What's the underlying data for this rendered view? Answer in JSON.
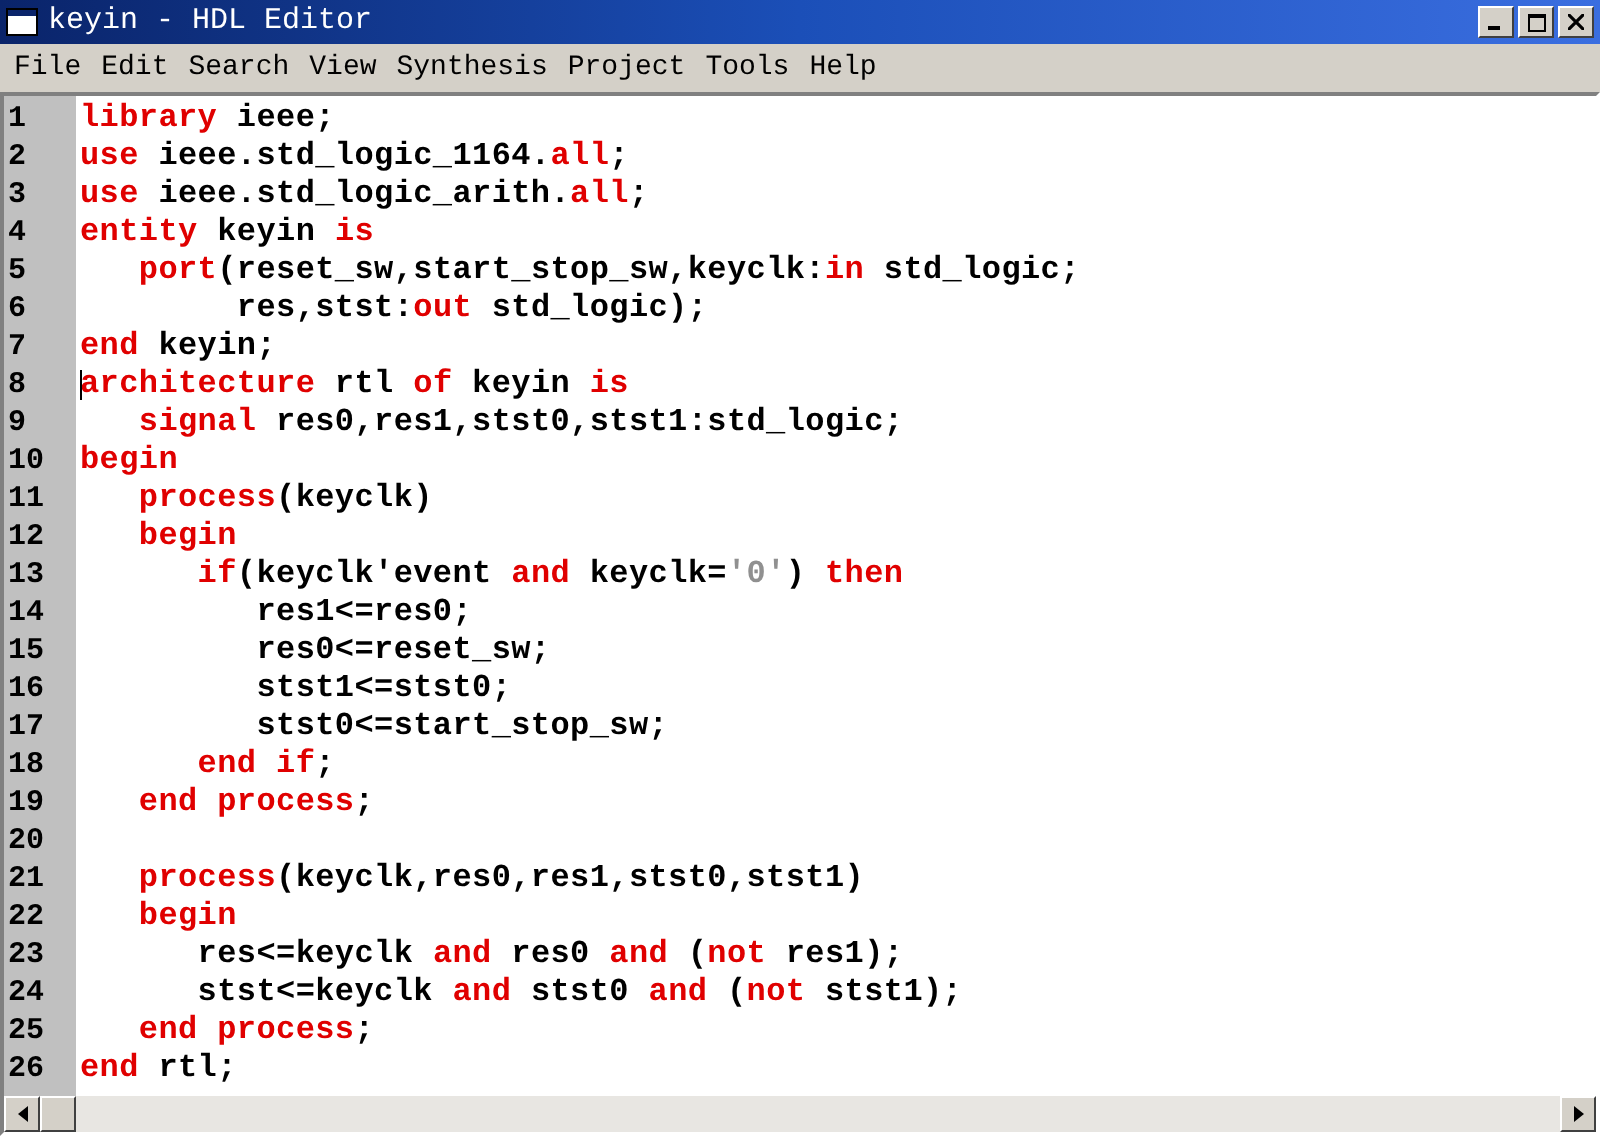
{
  "window": {
    "title": "keyin - HDL Editor"
  },
  "menu": [
    "File",
    "Edit",
    "Search",
    "View",
    "Synthesis",
    "Project",
    "Tools",
    "Help"
  ],
  "lines": [
    {
      "number": "1",
      "caret": false,
      "tokens": [
        {
          "kind": "keyword",
          "text": "library"
        },
        {
          "kind": "plain",
          "text": " ieee;"
        }
      ]
    },
    {
      "number": "2",
      "caret": false,
      "tokens": [
        {
          "kind": "keyword",
          "text": "use"
        },
        {
          "kind": "plain",
          "text": " ieee.std_logic_1164."
        },
        {
          "kind": "keyword",
          "text": "all"
        },
        {
          "kind": "plain",
          "text": ";"
        }
      ]
    },
    {
      "number": "3",
      "caret": false,
      "tokens": [
        {
          "kind": "keyword",
          "text": "use"
        },
        {
          "kind": "plain",
          "text": " ieee.std_logic_arith."
        },
        {
          "kind": "keyword",
          "text": "all"
        },
        {
          "kind": "plain",
          "text": ";"
        }
      ]
    },
    {
      "number": "4",
      "caret": false,
      "tokens": [
        {
          "kind": "keyword",
          "text": "entity"
        },
        {
          "kind": "plain",
          "text": " keyin "
        },
        {
          "kind": "keyword",
          "text": "is"
        }
      ]
    },
    {
      "number": "5",
      "caret": false,
      "tokens": [
        {
          "kind": "keyword",
          "text": "   port"
        },
        {
          "kind": "plain",
          "text": "(reset_sw,start_stop_sw,keyclk:"
        },
        {
          "kind": "keyword",
          "text": "in"
        },
        {
          "kind": "plain",
          "text": " std_logic;"
        }
      ]
    },
    {
      "number": "6",
      "caret": false,
      "tokens": [
        {
          "kind": "plain",
          "text": "        res,stst:"
        },
        {
          "kind": "keyword",
          "text": "out"
        },
        {
          "kind": "plain",
          "text": " std_logic);"
        }
      ]
    },
    {
      "number": "7",
      "caret": false,
      "tokens": [
        {
          "kind": "keyword",
          "text": "end"
        },
        {
          "kind": "plain",
          "text": " keyin;"
        }
      ]
    },
    {
      "number": "8",
      "caret": true,
      "tokens": [
        {
          "kind": "keyword",
          "text": "architecture"
        },
        {
          "kind": "plain",
          "text": " rtl "
        },
        {
          "kind": "keyword",
          "text": "of"
        },
        {
          "kind": "plain",
          "text": " keyin "
        },
        {
          "kind": "keyword",
          "text": "is"
        }
      ]
    },
    {
      "number": "9",
      "caret": false,
      "tokens": [
        {
          "kind": "keyword",
          "text": "   signal"
        },
        {
          "kind": "plain",
          "text": " res0,res1,stst0,stst1:std_logic;"
        }
      ]
    },
    {
      "number": "10",
      "caret": false,
      "tokens": [
        {
          "kind": "keyword",
          "text": "begin"
        }
      ]
    },
    {
      "number": "11",
      "caret": false,
      "tokens": [
        {
          "kind": "keyword",
          "text": "   process"
        },
        {
          "kind": "plain",
          "text": "(keyclk)"
        }
      ]
    },
    {
      "number": "12",
      "caret": false,
      "tokens": [
        {
          "kind": "keyword",
          "text": "   begin"
        }
      ]
    },
    {
      "number": "13",
      "caret": false,
      "tokens": [
        {
          "kind": "keyword",
          "text": "      if"
        },
        {
          "kind": "plain",
          "text": "(keyclk'event "
        },
        {
          "kind": "keyword",
          "text": "and"
        },
        {
          "kind": "plain",
          "text": " keyclk="
        },
        {
          "kind": "literal",
          "text": "'0'"
        },
        {
          "kind": "plain",
          "text": ") "
        },
        {
          "kind": "keyword",
          "text": "then"
        }
      ]
    },
    {
      "number": "14",
      "caret": false,
      "tokens": [
        {
          "kind": "plain",
          "text": "         res1<=res0;"
        }
      ]
    },
    {
      "number": "15",
      "caret": false,
      "tokens": [
        {
          "kind": "plain",
          "text": "         res0<=reset_sw;"
        }
      ]
    },
    {
      "number": "16",
      "caret": false,
      "tokens": [
        {
          "kind": "plain",
          "text": "         stst1<=stst0;"
        }
      ]
    },
    {
      "number": "17",
      "caret": false,
      "tokens": [
        {
          "kind": "plain",
          "text": "         stst0<=start_stop_sw;"
        }
      ]
    },
    {
      "number": "18",
      "caret": false,
      "tokens": [
        {
          "kind": "keyword",
          "text": "      end if"
        },
        {
          "kind": "plain",
          "text": ";"
        }
      ]
    },
    {
      "number": "19",
      "caret": false,
      "tokens": [
        {
          "kind": "keyword",
          "text": "   end process"
        },
        {
          "kind": "plain",
          "text": ";"
        }
      ]
    },
    {
      "number": "20",
      "caret": false
    },
    {
      "number": "21",
      "caret": false,
      "tokens": [
        {
          "kind": "keyword",
          "text": "   process"
        },
        {
          "kind": "plain",
          "text": "(keyclk,res0,res1,stst0,stst1)"
        }
      ]
    },
    {
      "number": "22",
      "caret": false,
      "tokens": [
        {
          "kind": "keyword",
          "text": "   begin"
        }
      ]
    },
    {
      "number": "23",
      "caret": false,
      "tokens": [
        {
          "kind": "plain",
          "text": "      res<=keyclk "
        },
        {
          "kind": "keyword",
          "text": "and"
        },
        {
          "kind": "plain",
          "text": " res0 "
        },
        {
          "kind": "keyword",
          "text": "and"
        },
        {
          "kind": "plain",
          "text": " ("
        },
        {
          "kind": "keyword",
          "text": "not"
        },
        {
          "kind": "plain",
          "text": " res1);"
        }
      ]
    },
    {
      "number": "24",
      "caret": false,
      "tokens": [
        {
          "kind": "plain",
          "text": "      stst<=keyclk "
        },
        {
          "kind": "keyword",
          "text": "and"
        },
        {
          "kind": "plain",
          "text": " stst0 "
        },
        {
          "kind": "keyword",
          "text": "and"
        },
        {
          "kind": "plain",
          "text": " ("
        },
        {
          "kind": "keyword",
          "text": "not"
        },
        {
          "kind": "plain",
          "text": " stst1);"
        }
      ]
    },
    {
      "number": "25",
      "caret": false,
      "tokens": [
        {
          "kind": "keyword",
          "text": "   end process"
        },
        {
          "kind": "plain",
          "text": ";"
        }
      ]
    },
    {
      "number": "26",
      "caret": false,
      "tokens": [
        {
          "kind": "keyword",
          "text": "end"
        },
        {
          "kind": "plain",
          "text": " rtl;"
        }
      ]
    }
  ]
}
